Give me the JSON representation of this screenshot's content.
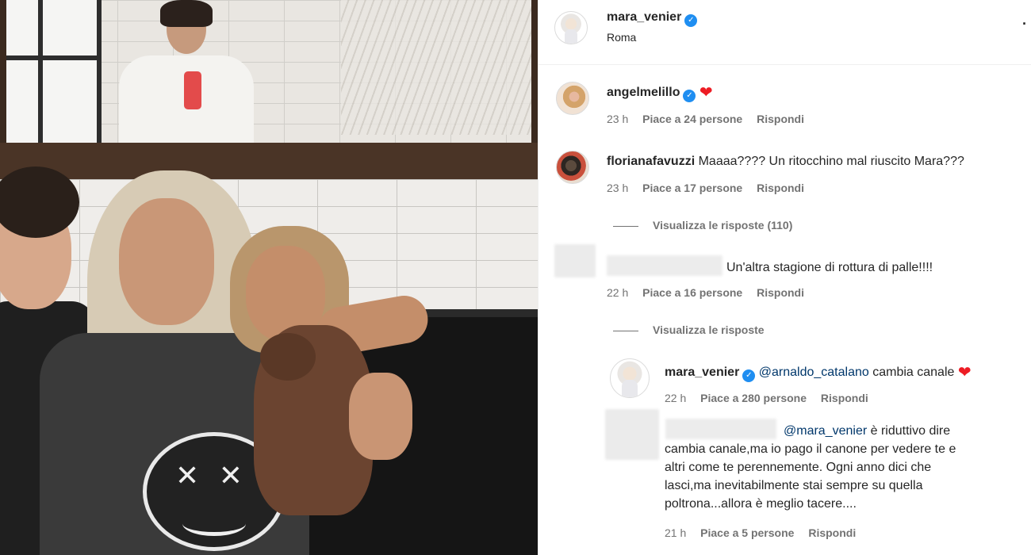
{
  "post": {
    "author": "mara_venier",
    "location": "Roma",
    "more_icon": "more-options-icon"
  },
  "comments": [
    {
      "username": "angelmelillo",
      "verified": true,
      "text": "",
      "emoji": "❤",
      "time": "23 h",
      "likes": "Piace a 24 persone",
      "reply": "Rispondi"
    },
    {
      "username": "florianafavuzzi",
      "verified": false,
      "text": "Maaaa???? Un ritocchino mal riuscito Mara???",
      "time": "23 h",
      "likes": "Piace a 17 persone",
      "reply": "Rispondi",
      "view_replies": "Visualizza le risposte (110)"
    },
    {
      "username": "",
      "verified": false,
      "text": "Un'altra stagione di rottura di palle!!!!",
      "time": "22 h",
      "likes": "Piace a 16 persone",
      "reply": "Rispondi",
      "view_replies": "Visualizza le risposte"
    }
  ],
  "replies": [
    {
      "username": "mara_venier",
      "verified": true,
      "mention": "@arnaldo_catalano",
      "text": "cambia canale",
      "emoji": "❤",
      "time": "22 h",
      "likes": "Piace a 280 persone",
      "reply": "Rispondi"
    },
    {
      "username": "",
      "mention": "@mara_venier",
      "text_line1": "è riduttivo dire",
      "text_line2": "cambia canale,ma io pago il canone per vedere te e",
      "text_line3": "altri come te perennemente. Ogni anno dici che",
      "text_line4": "lasci,ma inevitabilmente stai sempre su quella",
      "text_line5": "poltrona...allora è meglio tacere....",
      "time": "21 h",
      "likes": "Piace a 5 persone",
      "reply": "Rispondi"
    }
  ],
  "colors": {
    "verified": "#1f8ef1",
    "heart": "#ed1c24",
    "mention": "#00376b",
    "meta": "#737373",
    "text": "#262626"
  }
}
